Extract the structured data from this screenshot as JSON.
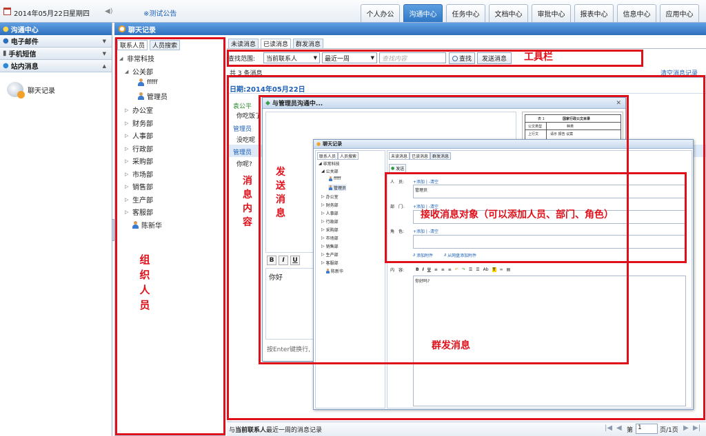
{
  "topbar": {
    "date": "2014年05月22日",
    "weekday": "星期四",
    "notice": "※测试公告",
    "nav_tabs": [
      "个人办公",
      "沟通中心",
      "任务中心",
      "文档中心",
      "审批中心",
      "报表中心",
      "信息中心",
      "应用中心"
    ],
    "active_tab": "沟通中心"
  },
  "left_panel": {
    "title": "沟通中心",
    "sections": [
      "电子邮件",
      "手机短信",
      "站内消息"
    ],
    "item": "聊天记录"
  },
  "main": {
    "title": "聊天记录"
  },
  "tree": {
    "tabs": [
      "联系人员",
      "人员搜索"
    ],
    "root": "非常科技",
    "dept_open": "公关部",
    "users": [
      "fffff",
      "管理员"
    ],
    "depts": [
      "办公室",
      "财务部",
      "人事部",
      "行政部",
      "采购部",
      "市场部",
      "销售部",
      "生产部",
      "客服部"
    ],
    "extra_user": "陈新华"
  },
  "msg_tabs": [
    "未读消息",
    "已读消息",
    "群发消息"
  ],
  "toolbar": {
    "scope_label": "查找范围:",
    "scope_value": "当前联系人",
    "period_value": "最近一周",
    "search_placeholder": "查找内容",
    "search_button": "查找",
    "send_button": "发送消息"
  },
  "count_text": "共 3 条消息",
  "clear_link": "清空消息记录",
  "date_header": "日期:2014年05月22日",
  "messages": [
    {
      "sender": "袁公平",
      "text": "你吃饭了"
    },
    {
      "sender": "管理员",
      "text": "没吃呢"
    },
    {
      "sender": "管理员",
      "text": "你呢?"
    }
  ],
  "chat_dialog": {
    "title": "与管理员沟通中...",
    "format_buttons": [
      "B",
      "I",
      "U"
    ],
    "input_text": "你好",
    "hint": "按Enter键换行,",
    "doc_thumb": {
      "num": "表 1",
      "title": "国家行政公文目录",
      "row1": [
        "公文类型",
        "种类"
      ],
      "row2": [
        "上行文",
        "请示 报告 议案"
      ]
    }
  },
  "bulk_dialog": {
    "title": "聊天记录",
    "tree_tabs": [
      "联系人员",
      "人员搜索"
    ],
    "tree_root": "非常科技",
    "tree_dept": "公关部",
    "tree_users": [
      "fffff",
      "管理员"
    ],
    "tree_depts": [
      "办公室",
      "财务部",
      "人事部",
      "行政部",
      "采购部",
      "市场部",
      "销售部",
      "生产部",
      "客服部"
    ],
    "tree_extra": "陈新华",
    "msg_tabs": [
      "未读消息",
      "已读消息",
      "群发消息"
    ],
    "send_btn": "发送",
    "person_label": "人　员:",
    "dept_label": "部　门:",
    "role_label": "角　色:",
    "add_clear": "+添加 | -清空",
    "person_value": "管理员",
    "attach": "添加附件",
    "attach_disk": "从网盘添加附件",
    "content_label": "内　容:",
    "content_text": "你好吗?",
    "toolbar_glyphs": [
      "B",
      "I",
      "U",
      "Ab",
      "T"
    ]
  },
  "footer": {
    "text_pre": "与",
    "text_bold": "当前联系人",
    "text_post": "最近一周的消息记录",
    "page_label": "第",
    "page_value": "1",
    "page_total": "页/1页"
  },
  "annotations": {
    "toolbar": "工具栏",
    "org": "组织人员",
    "msg_content": "消息内容",
    "send_msg": "发送消息",
    "receivers": "接收消息对象（可以添加人员、部门、角色）",
    "bulk": "群发消息"
  },
  "colors": {
    "accent": "#2e6fbc",
    "annotation": "#e0101a",
    "link": "#1b5fb5"
  }
}
